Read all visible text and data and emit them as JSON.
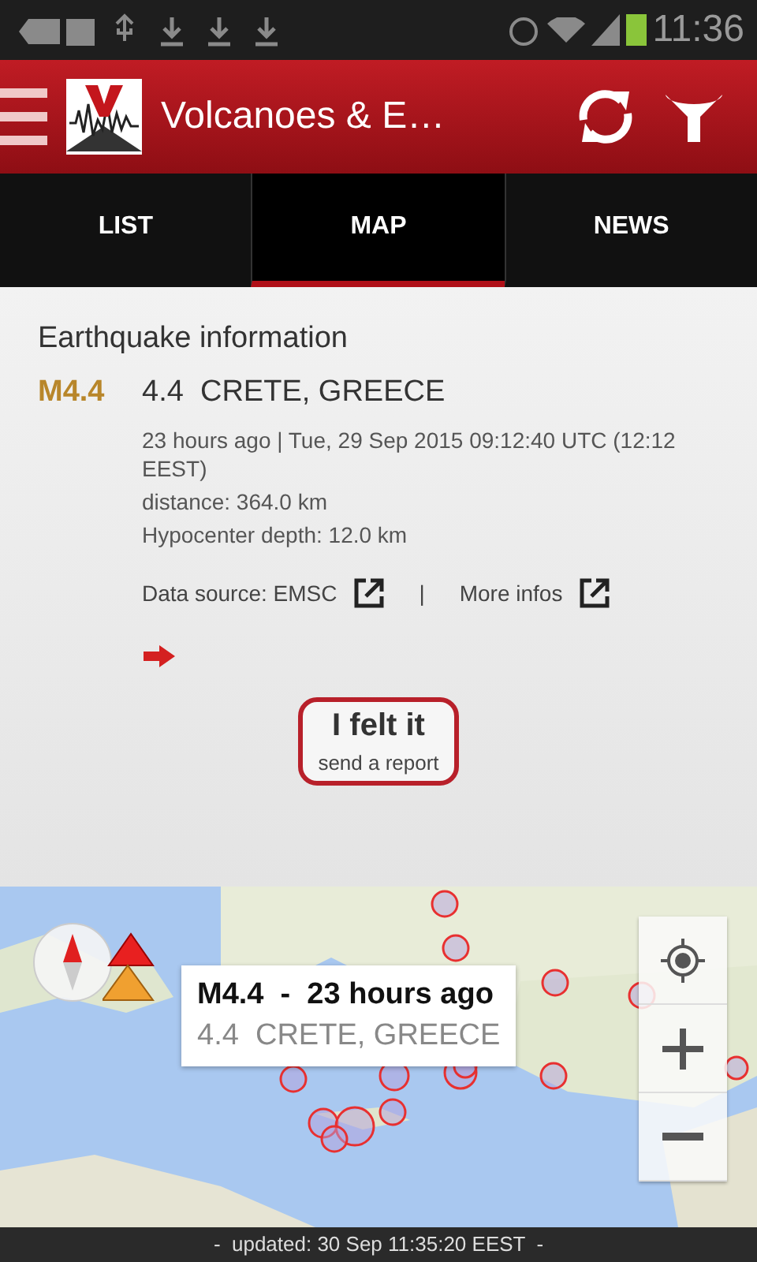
{
  "status_bar": {
    "time": "11:36"
  },
  "app_bar": {
    "title": "Volcanoes & E…"
  },
  "tabs": [
    {
      "label": "LIST",
      "selected": false
    },
    {
      "label": "MAP",
      "selected": true
    },
    {
      "label": "NEWS",
      "selected": false
    }
  ],
  "info": {
    "heading": "Earthquake information",
    "magnitude": "M4.4",
    "place": "4.4  CRETE, GREECE",
    "details": [
      "23 hours ago | Tue, 29 Sep 2015 09:12:40 UTC (12:12 EEST)",
      "distance: 364.0 km",
      "Hypocenter depth: 12.0 km"
    ],
    "links": [
      "Data source: EMSC",
      "More infos"
    ],
    "separator": "|"
  },
  "report_button": {
    "label": "I felt it",
    "sublabel": "send a report"
  },
  "map": {
    "popup": {
      "title": "M4.4  -  23 hours ago",
      "subtitle": "4.4  CRETE, GREECE"
    }
  },
  "footer": {
    "text": "-  updated: 30 Sep 11:35:20 EEST  -"
  }
}
